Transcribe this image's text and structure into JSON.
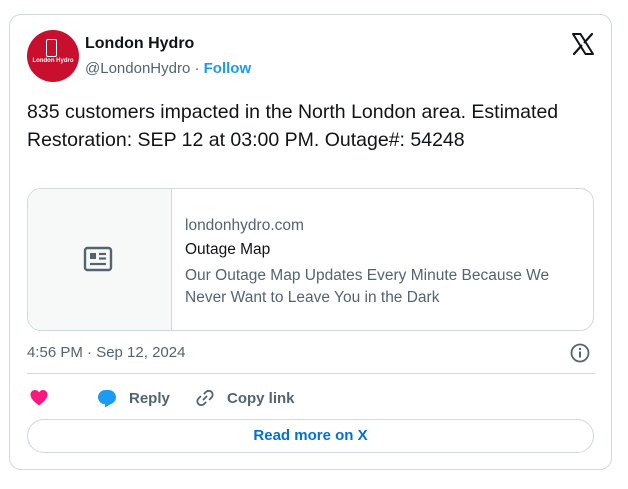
{
  "author": {
    "name": "London Hydro",
    "handle": "@LondonHydro",
    "separator": " · ",
    "follow_label": "Follow",
    "avatar_logo_text": "London Hydro"
  },
  "tweet": {
    "text": "835 customers impacted in the North London area. Estimated Restoration: SEP 12 at 03:00 PM. Outage#: 54248"
  },
  "link_card": {
    "domain": "londonhydro.com",
    "title": "Outage Map",
    "description": "Our Outage Map Updates Every Minute Because We Never Want to Leave You in the Dark"
  },
  "timestamp": "4:56 PM · Sep 12, 2024",
  "actions": {
    "reply_label": "Reply",
    "copy_label": "Copy link"
  },
  "read_more_label": "Read more on X",
  "colors": {
    "brand_red": "#c8102e",
    "link_blue": "#1d9bf0",
    "heart": "#f91880",
    "reply_bubble": "#1d9bf0",
    "read_more_blue": "#006fd6"
  },
  "icons": [
    "x-logo-icon",
    "article-icon",
    "info-icon",
    "heart-icon",
    "reply-icon",
    "link-icon"
  ]
}
